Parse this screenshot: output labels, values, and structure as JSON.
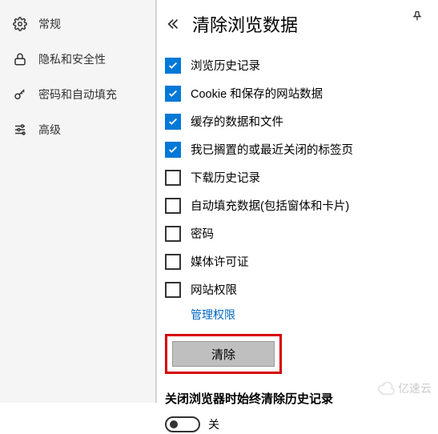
{
  "header": {
    "title": "清除浏览数据"
  },
  "sidebar": {
    "items": [
      {
        "label": "常规"
      },
      {
        "label": "隐私和安全性"
      },
      {
        "label": "密码和自动填充"
      },
      {
        "label": "高级"
      }
    ]
  },
  "options": [
    {
      "label": "浏览历史记录",
      "checked": true
    },
    {
      "label": "Cookie 和保存的网站数据",
      "checked": true
    },
    {
      "label": "缓存的数据和文件",
      "checked": true
    },
    {
      "label": "我已搁置的或最近关闭的标签页",
      "checked": true
    },
    {
      "label": "下载历史记录",
      "checked": false
    },
    {
      "label": "自动填充数据(包括窗体和卡片)",
      "checked": false
    },
    {
      "label": "密码",
      "checked": false
    },
    {
      "label": "媒体许可证",
      "checked": false
    },
    {
      "label": "网站权限",
      "checked": false
    }
  ],
  "links": {
    "manage_permissions": "管理权限"
  },
  "buttons": {
    "clear": "清除"
  },
  "alwaysClear": {
    "title": "关闭浏览器时始终清除历史记录",
    "state": "关"
  },
  "watermark": {
    "text": "亿速云"
  }
}
